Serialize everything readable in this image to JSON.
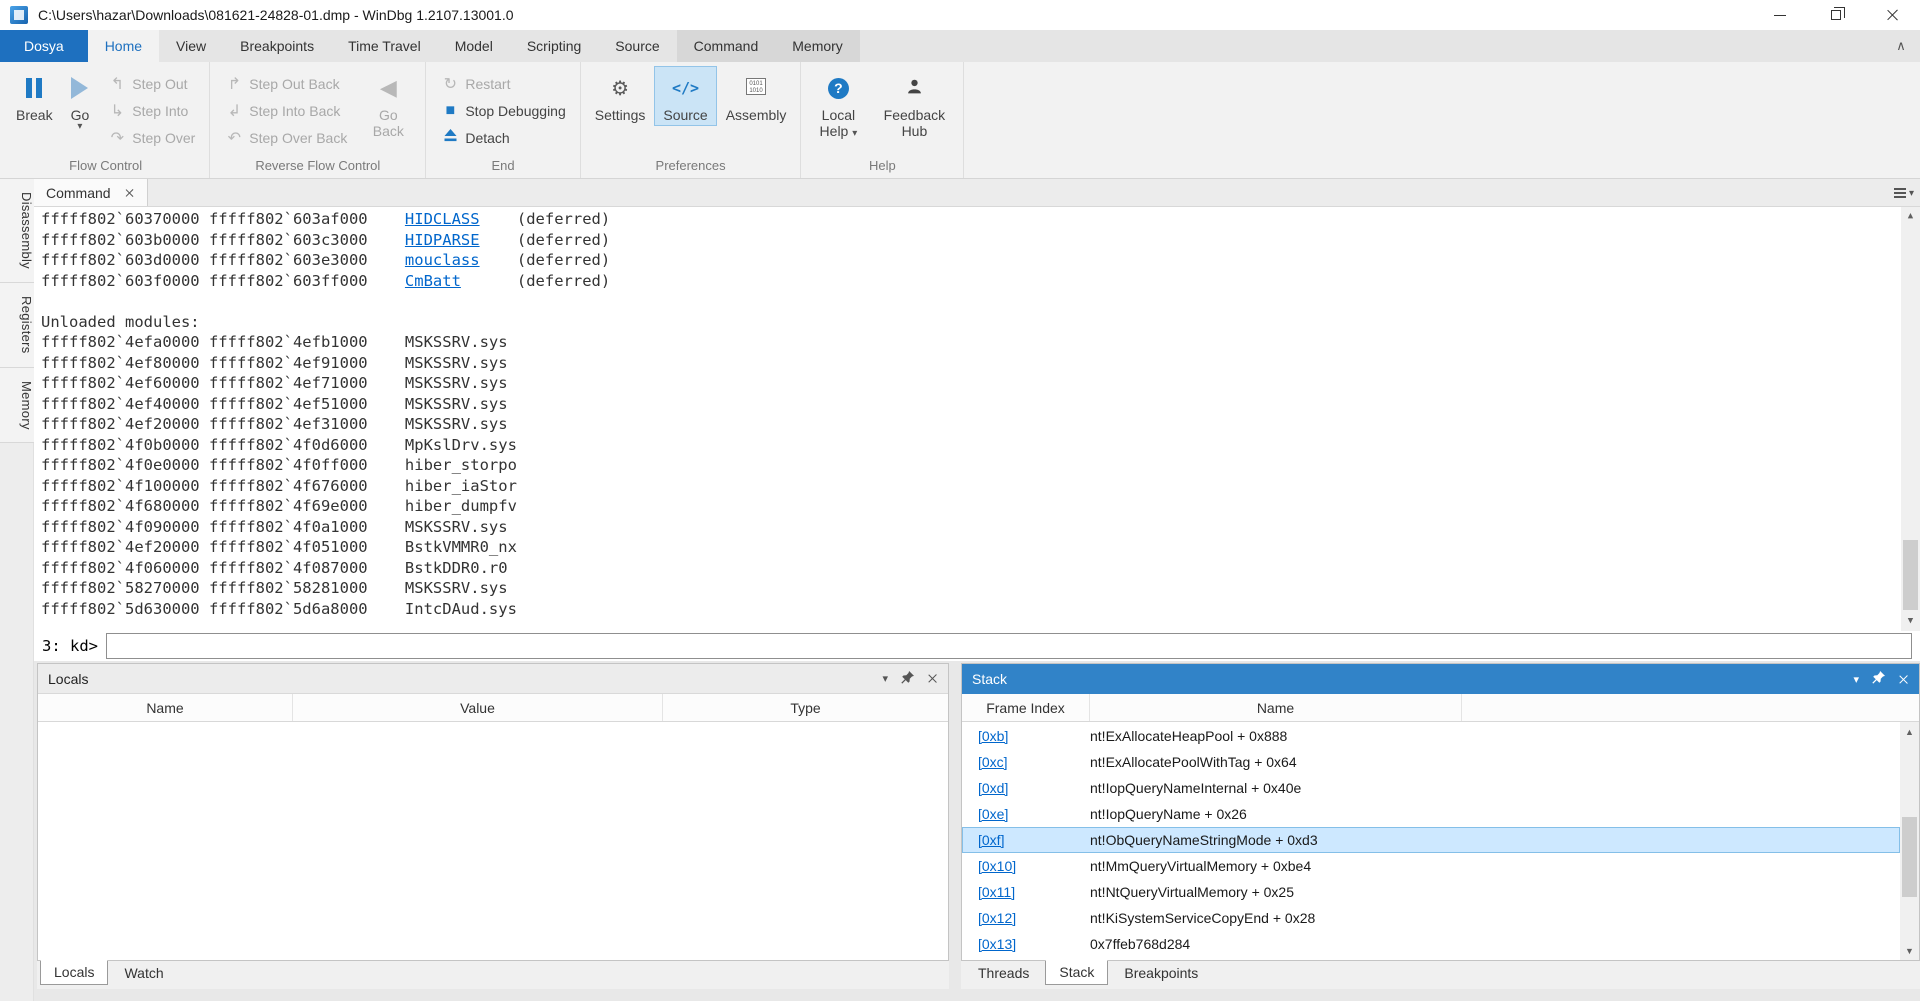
{
  "titlebar": {
    "title": "C:\\Users\\hazar\\Downloads\\081621-24828-01.dmp - WinDbg 1.2107.13001.0"
  },
  "ribbon_tabs": [
    {
      "label": "Dosya",
      "file": true
    },
    {
      "label": "Home",
      "selected": true
    },
    {
      "label": "View"
    },
    {
      "label": "Breakpoints"
    },
    {
      "label": "Time Travel"
    },
    {
      "label": "Model"
    },
    {
      "label": "Scripting"
    },
    {
      "label": "Source"
    },
    {
      "label": "Command",
      "shaded": true
    },
    {
      "label": "Memory",
      "shaded": true
    }
  ],
  "ribbon": {
    "flow_control": {
      "label": "Flow Control",
      "break": "Break",
      "go": "Go",
      "step_out": "Step Out",
      "step_into": "Step Into",
      "step_over": "Step Over"
    },
    "reverse": {
      "label": "Reverse Flow Control",
      "step_out_back": "Step Out Back",
      "step_into_back": "Step Into Back",
      "step_over_back": "Step Over Back",
      "go_back": "Go Back"
    },
    "end": {
      "label": "End",
      "restart": "Restart",
      "stop": "Stop Debugging",
      "detach": "Detach"
    },
    "preferences": {
      "label": "Preferences",
      "settings": "Settings",
      "source": "Source",
      "assembly": "Assembly"
    },
    "help": {
      "label": "Help",
      "local_help": "Local Help",
      "feedback_hub": "Feedback Hub"
    }
  },
  "side_tabs": [
    {
      "label": "Disassembly"
    },
    {
      "label": "Registers"
    },
    {
      "label": "Memory"
    }
  ],
  "command_window": {
    "tab": "Command",
    "prompt": "3: kd>",
    "input_value": "",
    "lines": [
      {
        "addr1": "fffff802`60370000",
        "addr2": "fffff802`603af000",
        "module": "HIDCLASS",
        "is_link": true,
        "suffix": "(deferred)"
      },
      {
        "addr1": "fffff802`603b0000",
        "addr2": "fffff802`603c3000",
        "module": "HIDPARSE",
        "is_link": true,
        "suffix": "(deferred)"
      },
      {
        "addr1": "fffff802`603d0000",
        "addr2": "fffff802`603e3000",
        "module": "mouclass",
        "is_link": true,
        "suffix": "(deferred)"
      },
      {
        "addr1": "fffff802`603f0000",
        "addr2": "fffff802`603ff000",
        "module": "CmBatt",
        "is_link": true,
        "suffix": "(deferred)"
      },
      {},
      {
        "text": "Unloaded modules:"
      },
      {
        "addr1": "fffff802`4efa0000",
        "addr2": "fffff802`4efb1000",
        "module": "MSKSSRV.sys"
      },
      {
        "addr1": "fffff802`4ef80000",
        "addr2": "fffff802`4ef91000",
        "module": "MSKSSRV.sys"
      },
      {
        "addr1": "fffff802`4ef60000",
        "addr2": "fffff802`4ef71000",
        "module": "MSKSSRV.sys"
      },
      {
        "addr1": "fffff802`4ef40000",
        "addr2": "fffff802`4ef51000",
        "module": "MSKSSRV.sys"
      },
      {
        "addr1": "fffff802`4ef20000",
        "addr2": "fffff802`4ef31000",
        "module": "MSKSSRV.sys"
      },
      {
        "addr1": "fffff802`4f0b0000",
        "addr2": "fffff802`4f0d6000",
        "module": "MpKslDrv.sys"
      },
      {
        "addr1": "fffff802`4f0e0000",
        "addr2": "fffff802`4f0ff000",
        "module": "hiber_storpo"
      },
      {
        "addr1": "fffff802`4f100000",
        "addr2": "fffff802`4f676000",
        "module": "hiber_iaStor"
      },
      {
        "addr1": "fffff802`4f680000",
        "addr2": "fffff802`4f69e000",
        "module": "hiber_dumpfv"
      },
      {
        "addr1": "fffff802`4f090000",
        "addr2": "fffff802`4f0a1000",
        "module": "MSKSSRV.sys"
      },
      {
        "addr1": "fffff802`4ef20000",
        "addr2": "fffff802`4f051000",
        "module": "BstkVMMR0_nx"
      },
      {
        "addr1": "fffff802`4f060000",
        "addr2": "fffff802`4f087000",
        "module": "BstkDDR0.r0"
      },
      {
        "addr1": "fffff802`58270000",
        "addr2": "fffff802`58281000",
        "module": "MSKSSRV.sys"
      },
      {
        "addr1": "fffff802`5d630000",
        "addr2": "fffff802`5d6a8000",
        "module": "IntcDAud.sys"
      }
    ]
  },
  "locals_panel": {
    "title": "Locals",
    "columns": [
      "Name",
      "Value",
      "Type"
    ],
    "tabs": [
      {
        "label": "Locals",
        "selected": true
      },
      {
        "label": "Watch"
      }
    ]
  },
  "stack_panel": {
    "title": "Stack",
    "columns": [
      "Frame Index",
      "Name"
    ],
    "frames": [
      {
        "frame": "[0xb]",
        "name": "nt!ExAllocateHeapPool + 0x888"
      },
      {
        "frame": "[0xc]",
        "name": "nt!ExAllocatePoolWithTag + 0x64"
      },
      {
        "frame": "[0xd]",
        "name": "nt!IopQueryNameInternal + 0x40e"
      },
      {
        "frame": "[0xe]",
        "name": "nt!IopQueryName + 0x26"
      },
      {
        "frame": "[0xf]",
        "name": "nt!ObQueryNameStringMode + 0xd3",
        "selected": true
      },
      {
        "frame": "[0x10]",
        "name": "nt!MmQueryVirtualMemory + 0xbe4"
      },
      {
        "frame": "[0x11]",
        "name": "nt!NtQueryVirtualMemory + 0x25"
      },
      {
        "frame": "[0x12]",
        "name": "nt!KiSystemServiceCopyEnd + 0x28"
      },
      {
        "frame": "[0x13]",
        "name": "0x7ffeb768d284"
      }
    ],
    "tabs": [
      {
        "label": "Threads"
      },
      {
        "label": "Stack",
        "selected": true
      },
      {
        "label": "Breakpoints"
      }
    ]
  },
  "colors": {
    "accent_blue": "#1e70bf",
    "file_tab_blue": "#1e70bf",
    "stack_header_blue": "#3183c8",
    "link_blue": "#0066cc",
    "selection_bg": "#cde8ff",
    "selection_border": "#84bfe8",
    "stop_red": "#cf3a2b"
  }
}
